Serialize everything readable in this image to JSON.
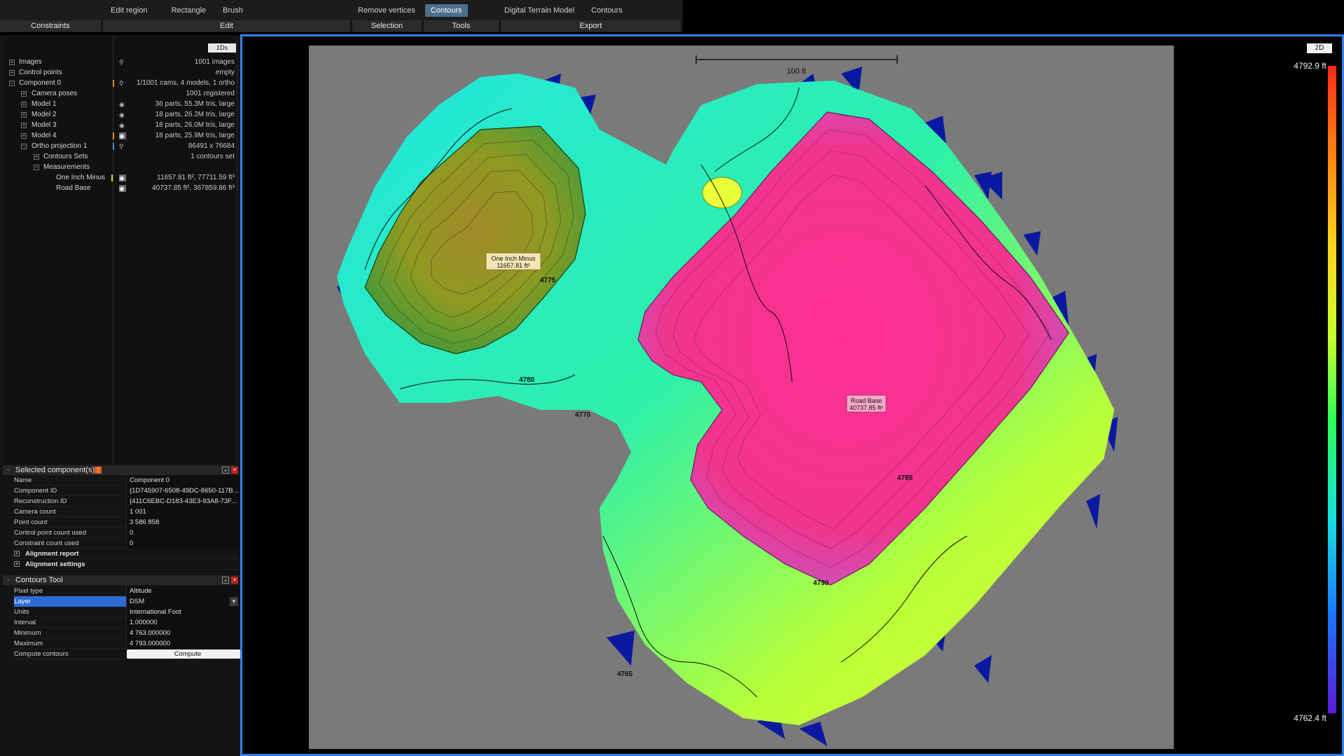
{
  "ribbon": {
    "top_buttons": [
      {
        "label": "Edit region",
        "active": false
      },
      {
        "label": "Rectangle",
        "active": false
      },
      {
        "label": "Brush",
        "active": false
      },
      {
        "label": "Remove vertices",
        "active": false
      },
      {
        "label": "Contours",
        "active": true
      },
      {
        "label": "Digital Terrain Model",
        "active": false
      },
      {
        "label": "Contours",
        "active": false
      }
    ],
    "groups": [
      "Constraints",
      "Edit",
      "Selection",
      "Tools",
      "Export"
    ]
  },
  "tree": {
    "badge": "1Ds",
    "rows": [
      {
        "label": "Images",
        "value": "1001 images",
        "icon": "pin"
      },
      {
        "label": "Control points",
        "value": "empty",
        "icon": ""
      },
      {
        "label": "Component 0",
        "value": "1/1001 cams, 4 models, 1 ortho",
        "icon": "pin"
      },
      {
        "label": "Camera poses",
        "value": "1001 registered",
        "icon": ""
      },
      {
        "label": "Model 1",
        "value": "36 parts, 55.3M tris, large",
        "icon": "eye"
      },
      {
        "label": "Model 2",
        "value": "18 parts, 26.2M tris, large",
        "icon": "eye"
      },
      {
        "label": "Model 3",
        "value": "18 parts, 26.0M tris, large",
        "icon": "eye"
      },
      {
        "label": "Model 4",
        "value": "18 parts, 25.9M tris, large",
        "icon": "eye"
      },
      {
        "label": "Ortho projection 1",
        "value": "86491 x 76684",
        "icon": "pin"
      },
      {
        "label": "Contours Sets",
        "value": "1 contours set",
        "icon": ""
      },
      {
        "label": "Measurements",
        "value": "",
        "icon": ""
      },
      {
        "label": "One Inch Minus",
        "value": "11657.81 ft², 77711.59 ft³",
        "icon": "eye"
      },
      {
        "label": "Road Base",
        "value": "40737.85 ft², 367859.86 ft³",
        "icon": "eye"
      }
    ]
  },
  "selected_component": {
    "title": "Selected component(s)",
    "props": [
      {
        "name": "Name",
        "value": "Component 0"
      },
      {
        "name": "Component ID",
        "value": "{1D745907-6508-49DC-8650-117B..."
      },
      {
        "name": "Reconstruction ID",
        "value": "{411C6EBC-D183-43E3-93A8-73F..."
      },
      {
        "name": "Camera count",
        "value": "1 001"
      },
      {
        "name": "Point count",
        "value": "3 586 858"
      },
      {
        "name": "Control point count used",
        "value": "0"
      },
      {
        "name": "Constraint count used",
        "value": "0"
      }
    ],
    "groups": [
      "Alignment report",
      "Alignment settings"
    ]
  },
  "contours_tool": {
    "title": "Contours Tool",
    "props": [
      {
        "name": "Pixel type",
        "value": "Altitude"
      },
      {
        "name": "Layer",
        "value": "DSM"
      },
      {
        "name": "Units",
        "value": "International Foot"
      },
      {
        "name": "Interval",
        "value": "1.000000"
      },
      {
        "name": "Minimum",
        "value": "4 763.000000"
      },
      {
        "name": "Maximum",
        "value": "4 793.000000"
      }
    ],
    "compute_label": "Compute contours",
    "compute_button": "Compute"
  },
  "viewport": {
    "view_mode": "2D",
    "scale_label": "100 ft",
    "legend_max": "4792.9 ft",
    "legend_min": "4762.4 ft",
    "measurements": [
      {
        "name": "One Inch Minus",
        "area": "11657.81 ft²"
      },
      {
        "name": "Road Base",
        "area": "40737.85 ft²"
      }
    ],
    "contour_labels": [
      "4775",
      "4780",
      "4785",
      "4790",
      "4770",
      "4765"
    ]
  },
  "colors": {
    "accent": "#2f83e6",
    "cyan": "#1fd8f0",
    "green": "#7ef24a",
    "yellow": "#e8ff3a",
    "olive": "#7a9a1e",
    "magenta": "#f0388a",
    "pink": "#ff3fa0",
    "blue_artifact": "#0a1aa0"
  }
}
